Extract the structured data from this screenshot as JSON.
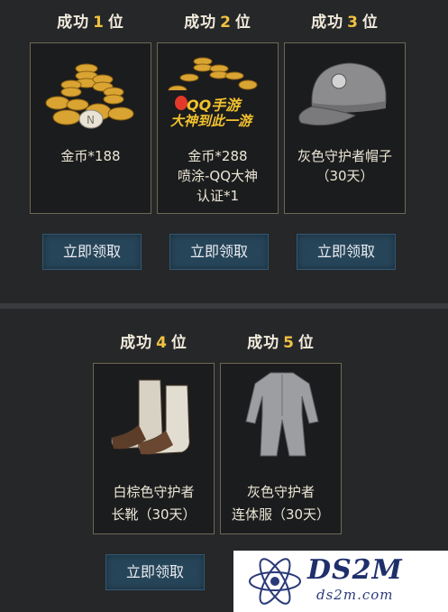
{
  "ranks": [
    {
      "prefix": "成功",
      "num": "1",
      "suffix": "位",
      "line1": "金币*188",
      "line2": "",
      "line3": ""
    },
    {
      "prefix": "成功",
      "num": "2",
      "suffix": "位",
      "line1": "金币*288",
      "line2": "喷涂-QQ大神",
      "line3": "认证*1",
      "badge_line1": "QQ手游",
      "badge_line2": "大神到此一游"
    },
    {
      "prefix": "成功",
      "num": "3",
      "suffix": "位",
      "line1": "灰色守护者帽子",
      "line2": "（30天）",
      "line3": ""
    },
    {
      "prefix": "成功",
      "num": "4",
      "suffix": "位",
      "line1": "白棕色守护者",
      "line2": "长靴（30天）",
      "line3": ""
    },
    {
      "prefix": "成功",
      "num": "5",
      "suffix": "位",
      "line1": "灰色守护者",
      "line2": "连体服（30天）",
      "line3": ""
    }
  ],
  "claim_label": "立即领取",
  "watermark": {
    "brand": "DS2M",
    "site": "ds2m.com"
  },
  "colors": {
    "accent_number": "#f0c242",
    "button_bg": "#274559",
    "card_border": "#6e6755"
  }
}
